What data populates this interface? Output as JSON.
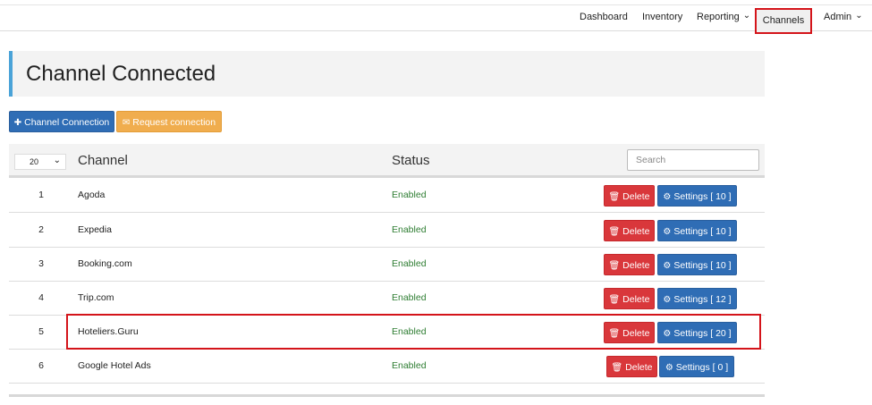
{
  "nav": {
    "items": [
      {
        "label": "Dashboard"
      },
      {
        "label": "Inventory"
      },
      {
        "label": "Reporting"
      },
      {
        "label": "Channels"
      },
      {
        "label": "Admin"
      }
    ]
  },
  "page": {
    "title": "Channel Connected"
  },
  "toolbar": {
    "channel_connection_label": "Channel Connection",
    "request_connection_label": "Request connection"
  },
  "table": {
    "page_size": "20",
    "headers": {
      "channel": "Channel",
      "status": "Status"
    },
    "search_placeholder": "Search",
    "delete_label": "Delete",
    "rows": [
      {
        "num": "1",
        "channel": "Agoda",
        "status": "Enabled",
        "settings_label": "Settings [ 10 ]"
      },
      {
        "num": "2",
        "channel": "Expedia",
        "status": "Enabled",
        "settings_label": "Settings [ 10 ]"
      },
      {
        "num": "3",
        "channel": "Booking.com",
        "status": "Enabled",
        "settings_label": "Settings [ 10 ]"
      },
      {
        "num": "4",
        "channel": "Trip.com",
        "status": "Enabled",
        "settings_label": "Settings [ 12 ]"
      },
      {
        "num": "5",
        "channel": "Hoteliers.Guru",
        "status": "Enabled",
        "settings_label": "Settings [ 20 ]"
      },
      {
        "num": "6",
        "channel": "Google Hotel Ads",
        "status": "Enabled",
        "settings_label": "Settings [ 0 ]"
      }
    ]
  },
  "colors": {
    "primary": "#2f6db5",
    "warning": "#f0ad4e",
    "danger": "#d9373b",
    "enabled": "#2e7d32",
    "highlight": "#d4141a",
    "accent_bar": "#4aa3d8"
  },
  "icons": [
    "plus-icon",
    "envelope-icon",
    "trash-icon",
    "gear-icon",
    "chevron-down-icon"
  ]
}
